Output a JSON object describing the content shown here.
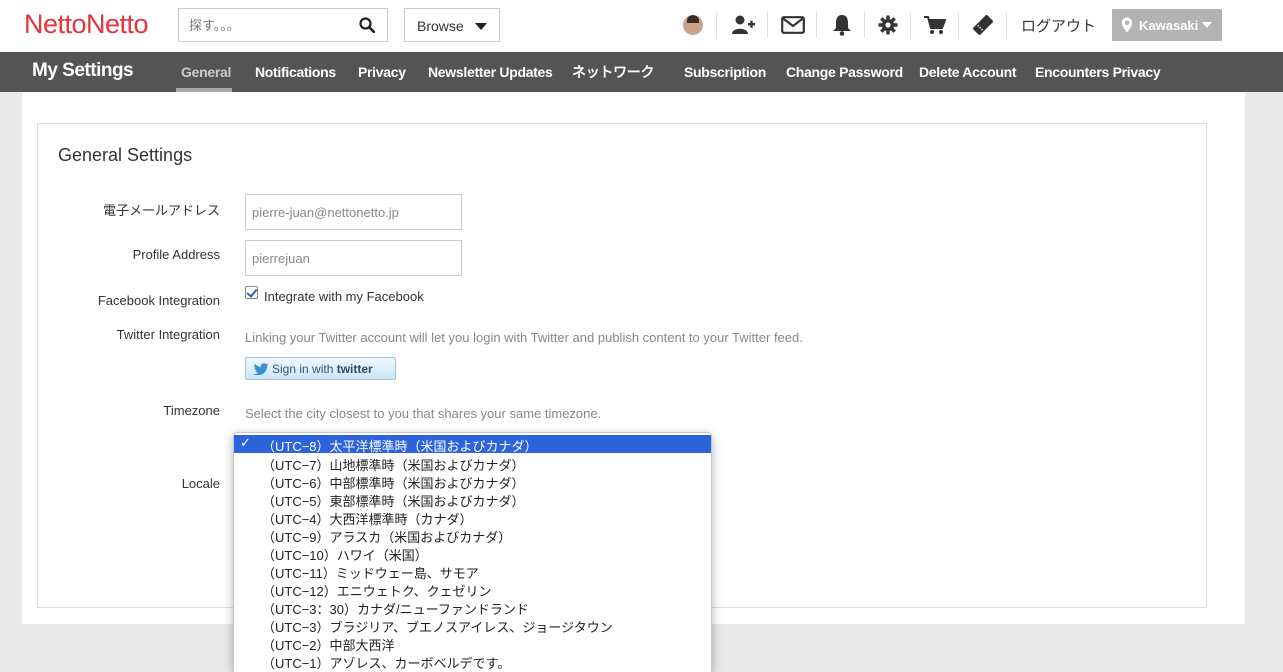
{
  "header": {
    "logo": "NettoNetto",
    "search_placeholder": "探す。。。",
    "browse_label": "Browse",
    "logout_label": "ログアウト",
    "location_label": "Kawasaki"
  },
  "subnav": {
    "title": "My Settings",
    "tabs": [
      {
        "label": "General"
      },
      {
        "label": "Notifications"
      },
      {
        "label": "Privacy"
      },
      {
        "label": "Newsletter Updates"
      },
      {
        "label": "ネットワーク"
      },
      {
        "label": "Subscription"
      },
      {
        "label": "Change Password"
      },
      {
        "label": "Delete Account"
      },
      {
        "label": "Encounters Privacy"
      }
    ],
    "active_tab": "General"
  },
  "settings": {
    "title": "General Settings",
    "email_label": "電子メールアドレス",
    "email_value": "pierre-juan@nettonetto.jp",
    "profile_label": "Profile Address",
    "profile_value": "pierrejuan",
    "facebook_label": "Facebook Integration",
    "facebook_checkbox_label": "Integrate with my Facebook",
    "facebook_checked": true,
    "twitter_label": "Twitter Integration",
    "twitter_help": "Linking your Twitter account will let you login with Twitter and publish content to your Twitter feed.",
    "twitter_button_prefix": "Sign in with",
    "twitter_button_brand": "twitter",
    "timezone_label": "Timezone",
    "timezone_help": "Select the city closest to you that shares your same timezone.",
    "locale_label": "Locale"
  },
  "timezone_options": [
    {
      "label": "（UTC−8）太平洋標準時（米国およびカナダ）",
      "selected": true
    },
    {
      "label": "（UTC−7）山地標準時（米国およびカナダ）"
    },
    {
      "label": "（UTC−6）中部標準時（米国およびカナダ）"
    },
    {
      "label": "（UTC−5）東部標準時（米国およびカナダ）"
    },
    {
      "label": "（UTC−4）大西洋標準時（カナダ）"
    },
    {
      "label": "（UTC−9）アラスカ（米国およびカナダ）"
    },
    {
      "label": "（UTC−10）ハワイ（米国）"
    },
    {
      "label": "（UTC−11）ミッドウェー島、サモア"
    },
    {
      "label": "（UTC−12）エニウェトク、クェゼリン"
    },
    {
      "label": "（UTC−3：30）カナダ/ニューファンドランド"
    },
    {
      "label": "（UTC−3）ブラジリア、ブエノスアイレス、ジョージタウン"
    },
    {
      "label": "（UTC−2）中部大西洋"
    },
    {
      "label": "（UTC−1）アゾレス、カーボベルデです。"
    }
  ],
  "selected_mark": "✓",
  "colors": {
    "brand": "#e8323c",
    "nav_bg": "#545454",
    "selection": "#2d64dc"
  }
}
